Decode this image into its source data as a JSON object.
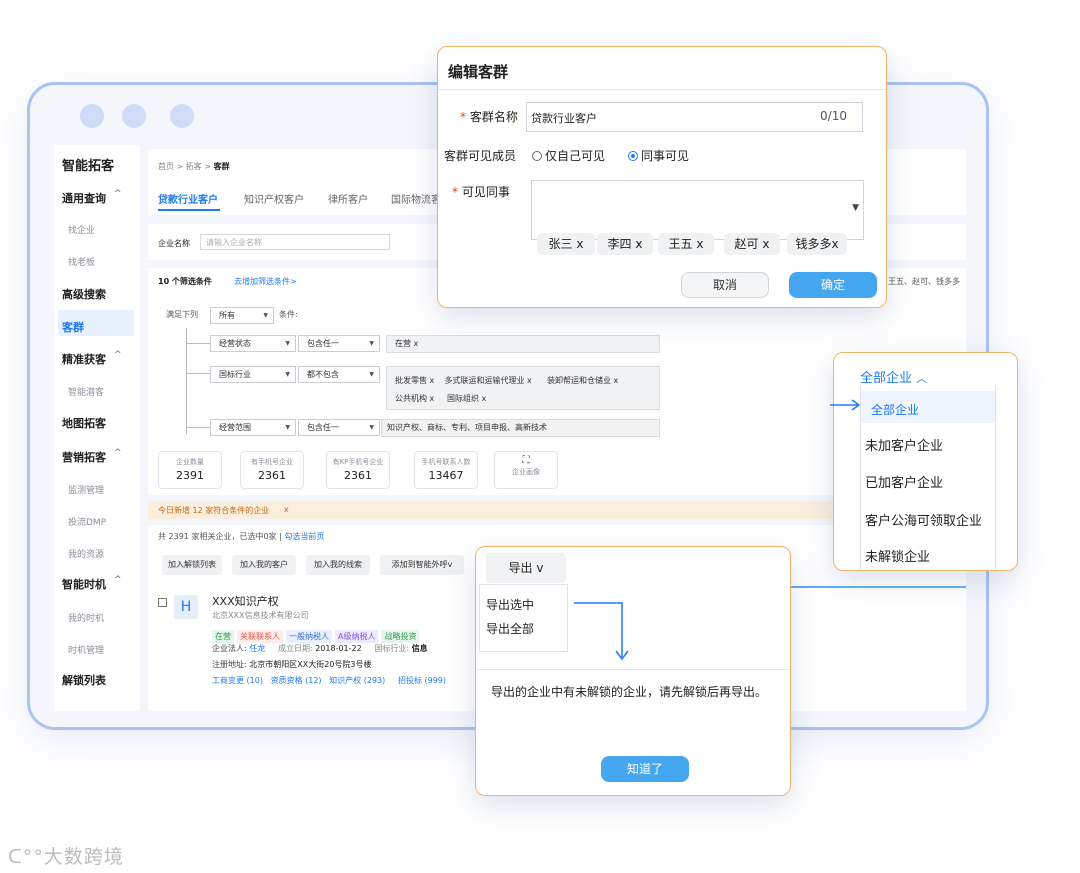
{
  "window": {
    "logo_title": "智能拓客"
  },
  "sidebar": {
    "items": [
      {
        "label": "通用查询",
        "chev": "^"
      },
      {
        "label": "找企业"
      },
      {
        "label": "找老板"
      },
      {
        "label": "高级搜索"
      },
      {
        "label": "客群"
      },
      {
        "label": "精准获客",
        "chev": "^"
      },
      {
        "label": "智能潜客"
      },
      {
        "label": "地图拓客"
      },
      {
        "label": "营销拓客",
        "chev": "^"
      },
      {
        "label": "监测管理"
      },
      {
        "label": "投流DMP"
      },
      {
        "label": "我的资源"
      },
      {
        "label": "智能时机",
        "chev": "^"
      },
      {
        "label": "我的时机"
      },
      {
        "label": "时机管理"
      },
      {
        "label": "解锁列表"
      }
    ]
  },
  "breadcrumb": {
    "home": "首页",
    "sep": ">",
    "mid": "拓客",
    "current": "客群"
  },
  "tabs": [
    "贷款行业客户",
    "知识产权客户",
    "律所客户",
    "国际物流客"
  ],
  "company_name": {
    "label": "企业名称",
    "placeholder": "请输入企业名称"
  },
  "filters": {
    "count_label": "10 个筛选条件",
    "add_link": "去增加筛选条件>",
    "right_overflow": "王五、赵可、钱多多",
    "satisfy_label": "满足下列",
    "satisfy_value": "所有",
    "condition_label": "条件:",
    "rows": [
      {
        "field": "经营状态",
        "op": "包含任一",
        "value": "在营 x"
      },
      {
        "field": "国标行业",
        "op": "都不包含",
        "value_line1": "批发零售 x    多式联运和运输代理业 x      装卸帮运和仓储业 x",
        "value_line2": "公共机构 x     国际组织 x"
      },
      {
        "field": "经营范围",
        "op": "包含任一",
        "value": "知识产权、商标、专利、项目申报、高新技术"
      }
    ]
  },
  "stats": [
    {
      "label": "企业数量",
      "value": "2391"
    },
    {
      "label": "有手机号企业",
      "value": "2361"
    },
    {
      "label": "有KP手机号企业",
      "value": "2361"
    },
    {
      "label": "手机号联系人数",
      "value": "13467"
    }
  ],
  "portrait": {
    "label": "企业画像"
  },
  "notice": {
    "text": "今日新增 12 家符合条件的企业",
    "close": "x"
  },
  "results": {
    "text": "共 2391 家相关企业，已选中0家",
    "link": "勾选当前页"
  },
  "actions": [
    "加入解锁列表",
    "加入我的客户",
    "加入我的线索",
    "添加到智能外呼v"
  ],
  "company": {
    "avatar": "H",
    "name": "XXX知识产权",
    "sub": "北京XXX信息技术有限公司",
    "tags": [
      "在营",
      "关联联系人",
      "一般纳税人",
      "A级纳税人",
      "战略投资"
    ],
    "legal_label": "企业法人:",
    "legal": "任龙",
    "date_label": "成立日期:",
    "date": "2018-01-22",
    "industry_label": "国标行业:",
    "industry": "信息",
    "address_label": "注册地址:",
    "address": "北京市朝阳区XX大街20号院3号楼",
    "links": "工商变更 (10)   资质资格 (12)   知识产权 (293)     招投标 (999)"
  },
  "edit_dialog": {
    "title": "编辑客群",
    "name_label": "客群名称",
    "name_value": "贷款行业客户",
    "name_count": "0/10",
    "visible_label": "客群可见成员",
    "radio_self": "仅自己可见",
    "radio_colleague": "同事可见",
    "colleagues_label": "可见同事",
    "chips": [
      "张三 x",
      "李四 x",
      "王五 x",
      "赵可 x",
      "钱多多x"
    ],
    "cancel": "取消",
    "confirm": "确定"
  },
  "dropdown": {
    "title": "全部企业",
    "options": [
      "全部企业",
      "未加客户企业",
      "已加客户企业",
      "客户公海可领取企业",
      "未解锁企业"
    ]
  },
  "export": {
    "button": "导出 v",
    "options": [
      "导出选中",
      "导出全部"
    ],
    "message": "导出的企业中有未解锁的企业，请先解锁后再导出。",
    "ok": "知道了"
  },
  "watermark": "大数跨境",
  "colors": {
    "primary": "#1e7bef",
    "dialog_border": "#f0b46a",
    "frame": "#a9c3f2"
  }
}
